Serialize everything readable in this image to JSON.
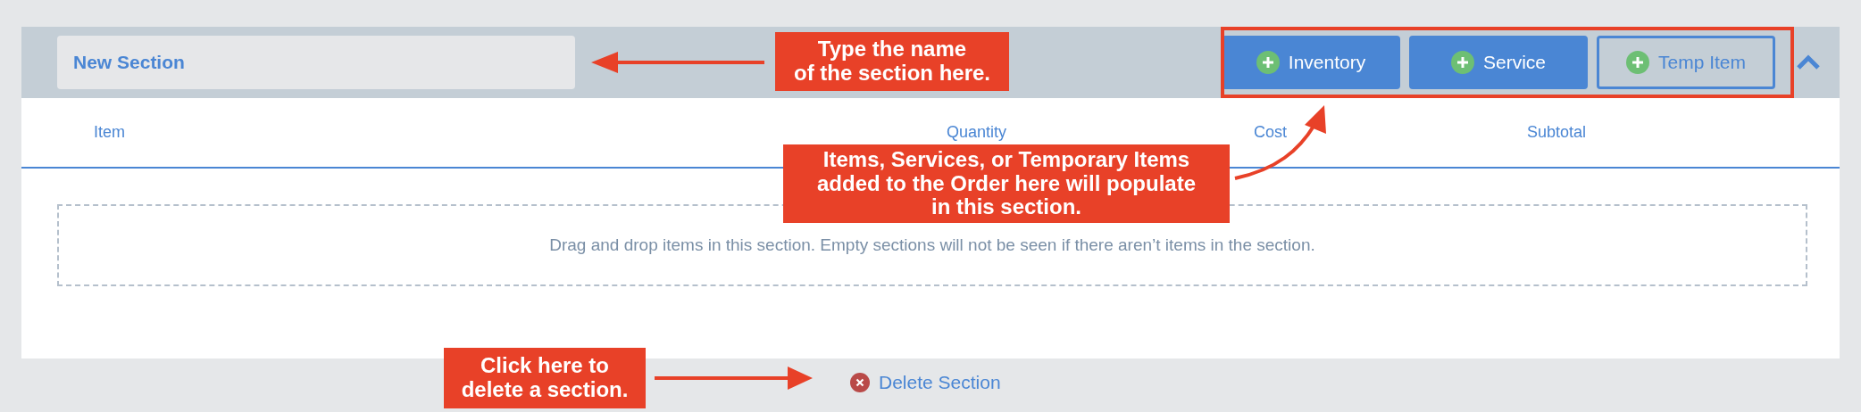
{
  "section": {
    "name": "New Section",
    "expanded": true,
    "buttons": [
      {
        "label": "Inventory",
        "kind": "solid"
      },
      {
        "label": "Service",
        "kind": "solid"
      },
      {
        "label": "Temp Item",
        "kind": "outline"
      }
    ],
    "columns": [
      "Item",
      "Quantity",
      "Cost",
      "Subtotal"
    ],
    "empty_message": "Drag and drop items in this section. Empty sections will not be seen if there aren’t items in the section.",
    "delete_label": "Delete Section"
  },
  "callouts": [
    {
      "text": "Type the name\nof the section here."
    },
    {
      "text": "Items, Services, or Temporary Items\nadded to the Order here will populate\nin this section."
    },
    {
      "text": "Click here to\ndelete a section."
    }
  ]
}
